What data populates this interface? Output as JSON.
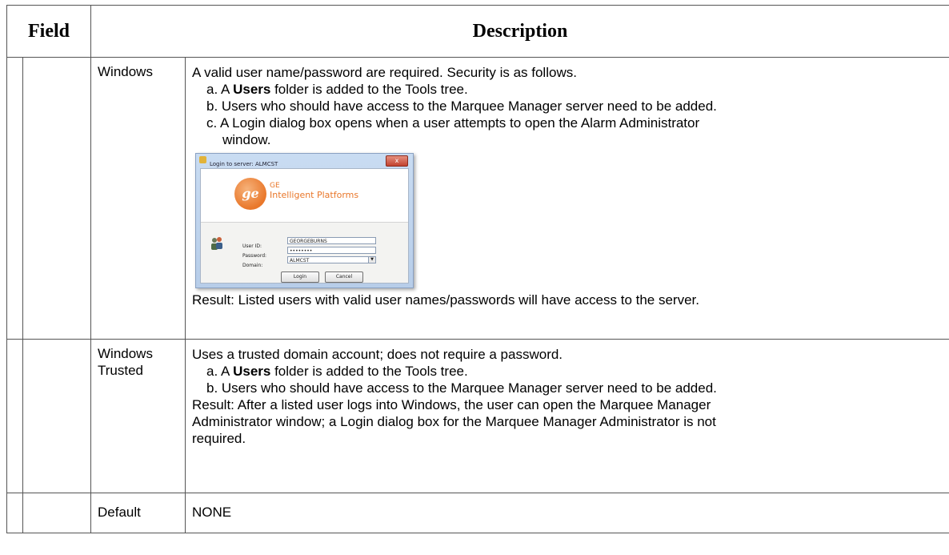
{
  "table": {
    "headers": {
      "field": "Field",
      "description": "Description"
    },
    "rows": [
      {
        "name": "Windows",
        "intro": "A valid user name/password are required. Security is as follows.",
        "items": [
          {
            "prefix": "a. A ",
            "bold": "Users",
            "suffix": " folder is added to the Tools tree."
          },
          {
            "text": "b. Users who should have access to the Marquee Manager server need to be added."
          },
          {
            "text_line1": "c. A Login dialog box opens when a user attempts to open the Alarm Administrator",
            "text_line2": "window."
          }
        ],
        "result": "Result: Listed  users with valid user names/passwords will have access to the server."
      },
      {
        "name_line1": "Windows",
        "name_line2": "Trusted",
        "intro": "Uses a trusted domain account; does not require a password.",
        "items": [
          {
            "prefix": "a. A ",
            "bold": "Users",
            "suffix": " folder is added to the Tools tree."
          },
          {
            "text": "b. Users who should have access to the Marquee Manager server need to be added."
          }
        ],
        "result_line1": "Result: After a listed user logs into Windows, the user can open the Marquee Manager",
        "result_line2": "Administrator  window; a Login dialog box for the Marquee Manager Administrator  is not",
        "result_line3": "required."
      },
      {
        "name": "Default",
        "description": "NONE"
      }
    ]
  },
  "login_dialog": {
    "title": "Login to server: ALMCST",
    "close_glyph": "x",
    "brand_line1": "GE",
    "brand_line2": "Intelligent Platforms",
    "logo_text": "ge",
    "user_id_label": "User ID:",
    "user_id_value": "GEORGEBURNS",
    "password_label": "Password:",
    "password_value": "••••••••",
    "domain_label": "Domain:",
    "domain_value": "ALMCST",
    "login_button": "Login",
    "cancel_button": "Cancel",
    "user_icon": "users-icon",
    "lock_icon": "lock-icon",
    "accent_color": "#e9772a"
  }
}
